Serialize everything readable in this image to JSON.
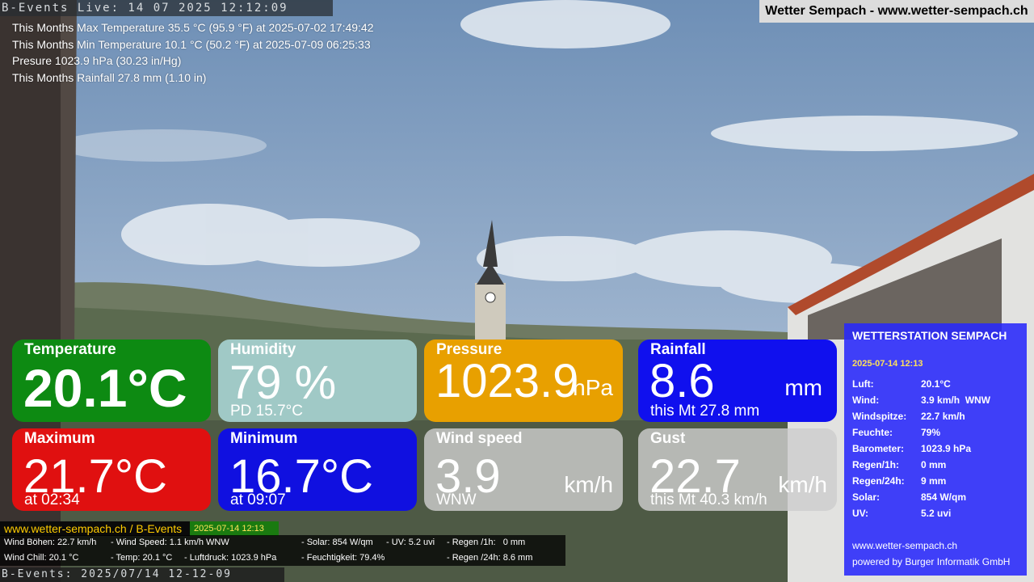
{
  "header": {
    "live_bar": "B-Events Live: 14 07 2025 12:12:09",
    "title": "Wetter Sempach - www.wetter-sempach.ch"
  },
  "stats": [
    "This Months Max Temperature 35.5 °C (95.9 °F) at 2025-07-02 17:49:42",
    "This Months Min Temperature 10.1 °C (50.2 °F) at 2025-07-09 06:25:33",
    "Presure 1023.9 hPa (30.23 in/Hg)",
    "This Months Rainfall 27.8 mm (1.10 in)"
  ],
  "tiles": {
    "temperature": {
      "label": "Temperature",
      "value": "20.1°C"
    },
    "humidity": {
      "label": "Humidity",
      "value": "79 %",
      "sub": "PD 15.7°C"
    },
    "pressure": {
      "label": "Pressure",
      "value": "1023.9",
      "unit": "hPa"
    },
    "rainfall": {
      "label": "Rainfall",
      "value": "8.6",
      "unit": "mm",
      "sub": "this Mt 27.8 mm"
    },
    "maximum": {
      "label": "Maximum",
      "value": "21.7°C",
      "sub": "at 02:34"
    },
    "minimum": {
      "label": "Minimum",
      "value": "16.7°C",
      "sub": "at 09:07"
    },
    "wind": {
      "label": "Wind speed",
      "value": "3.9",
      "unit": "km/h",
      "sub": "WNW"
    },
    "gust": {
      "label": "Gust",
      "value": "22.7",
      "unit": "km/h",
      "sub": "this Mt 40.3 km/h"
    }
  },
  "panel": {
    "title": "WETTERSTATION SEMPACH",
    "date": "2025-07-14 12:13",
    "rows": [
      {
        "k": "Luft:",
        "v": "20.1°C"
      },
      {
        "k": "Wind:",
        "v": "3.9 km/h  WNW"
      },
      {
        "k": "Windspitze:",
        "v": "22.7 km/h"
      },
      {
        "k": "Feuchte:",
        "v": "79%"
      },
      {
        "k": "Barometer:",
        "v": "1023.9 hPa"
      },
      {
        "k": "Regen/1h:",
        "v": "0 mm"
      },
      {
        "k": "Regen/24h:",
        "v": "9 mm"
      },
      {
        "k": "Solar:",
        "v": "854 W/qm"
      },
      {
        "k": "UV:",
        "v": "5.2 uvi"
      }
    ],
    "site": "www.wetter-sempach.ch",
    "powered": "powered by Burger Informatik GmbH"
  },
  "bottom": {
    "site": "www.wetter-sempach.ch / B-Events",
    "date": "2025-07-14 12:13",
    "line1": {
      "a": "Wind Böhen: 22.7 km/h",
      "b": "- Wind Speed: 1.1 km/h WNW",
      "c": "- Solar: 854 W/qm",
      "d": "- UV: 5.2 uvi",
      "e": "- Regen /1h:   0 mm"
    },
    "line2": {
      "a": "Wind Chill: 20.1 °C",
      "b": "- Temp: 20.1 °C",
      "c": "- Luftdruck: 1023.9 hPa",
      "d": "- Feuchtigkeit: 79.4%",
      "e": "- Regen /24h: 8.6 mm"
    },
    "live": "B-Events: 2025/07/14 12-12-09"
  }
}
